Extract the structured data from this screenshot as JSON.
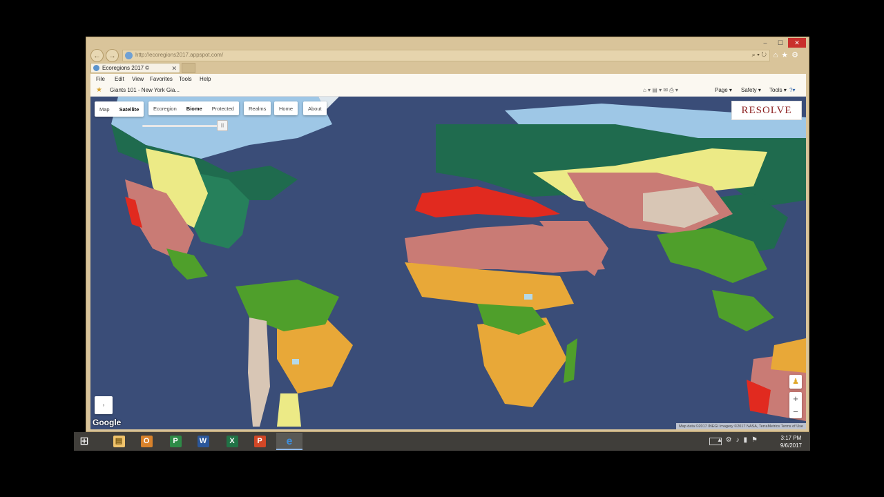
{
  "browser": {
    "window_buttons": [
      "–",
      "☐",
      "✕"
    ],
    "address": "http://ecoregions2017.appspot.com/",
    "address_controls": "⌕ ▾ ↻",
    "tab_title": "Ecoregions 2017 ©",
    "menus": [
      "File",
      "Edit",
      "View",
      "Favorites",
      "Tools",
      "Help"
    ],
    "favorite_link": "Giants 101 - New York Gia...",
    "command_bar": [
      "Page ▾",
      "Safety ▾",
      "Tools ▾"
    ]
  },
  "map": {
    "type_controls": [
      "Map",
      "Satellite"
    ],
    "layer_controls": [
      "Ecoregion",
      "Biome",
      "Protected"
    ],
    "realms_label": "Realms",
    "home_label": "Home",
    "about_label": "About",
    "logo": "RESOLVE",
    "google_label": "Google",
    "attribution": "Map data ©2017 INEGI Imagery ©2017 NASA, TerraMetrics   Terms of Use",
    "opacity_level": 0.9
  },
  "biome_colors": {
    "ocean": "#3a4d78",
    "tundra": "#9ec7e6",
    "boreal": "#1f6b4e",
    "temperate_broadleaf": "#26805b",
    "temperate_grassland": "#ecea86",
    "desert": "#c97b75",
    "mediterranean": "#e12a1f",
    "savanna": "#e8a838",
    "tropical_moist": "#4f9f2b",
    "montane": "#d8c6b5",
    "mangroves": "#b5d9e8"
  },
  "taskbar": {
    "apps": [
      {
        "name": "file-explorer",
        "glyph": "▤",
        "color": "#f0c36b"
      },
      {
        "name": "outlook",
        "glyph": "O",
        "color": "#d9822b"
      },
      {
        "name": "project",
        "glyph": "P",
        "color": "#2e8b47"
      },
      {
        "name": "word",
        "glyph": "W",
        "color": "#2b579a"
      },
      {
        "name": "excel",
        "glyph": "X",
        "color": "#217346"
      },
      {
        "name": "powerpoint",
        "glyph": "P",
        "color": "#d24726"
      },
      {
        "name": "internet-explorer",
        "glyph": "e",
        "color": "#3e8edc"
      }
    ],
    "time": "3:17 PM",
    "date": "9/6/2017"
  }
}
